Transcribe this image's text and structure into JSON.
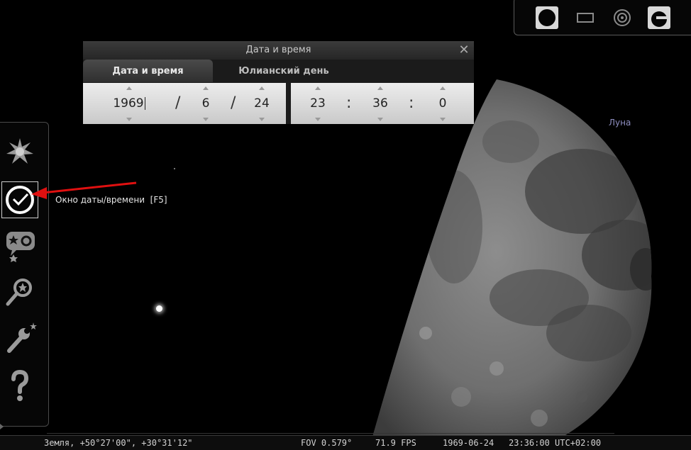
{
  "sky": {
    "object_label": "Луна"
  },
  "top_toolbar": {
    "icons": [
      "night-mode-icon",
      "fullscreen-icon",
      "ocular-icon",
      "telescope-control-icon"
    ]
  },
  "dialog": {
    "title": "Дата и время",
    "close_glyph": "✕",
    "tabs": [
      {
        "label": "Дата и время",
        "active": true
      },
      {
        "label": "Юлианский день",
        "active": false
      }
    ],
    "date": {
      "year": "1969",
      "month": "6",
      "day": "24",
      "separator": "/"
    },
    "time": {
      "hour": "23",
      "minute": "36",
      "second": "0",
      "separator": ":"
    }
  },
  "left_toolbar": {
    "items": [
      {
        "icon": "sky-display-icon"
      },
      {
        "icon": "clock-icon",
        "active": true
      },
      {
        "icon": "sky-culture-icon"
      },
      {
        "icon": "search-icon"
      },
      {
        "icon": "settings-icon"
      },
      {
        "icon": "help-icon"
      }
    ],
    "tooltip": "Окно даты/времени  [F5]"
  },
  "status_bar": {
    "location": "Земля, +50°27'00\", +30°31'12\"",
    "fov": "FOV 0.579°",
    "fps": "71.9 FPS",
    "date": "1969-06-24",
    "time": "23:36:00 UTC+02:00"
  },
  "colors": {
    "background": "#000000",
    "annotation_arrow": "#e01010",
    "label": "#8e8ec0"
  }
}
